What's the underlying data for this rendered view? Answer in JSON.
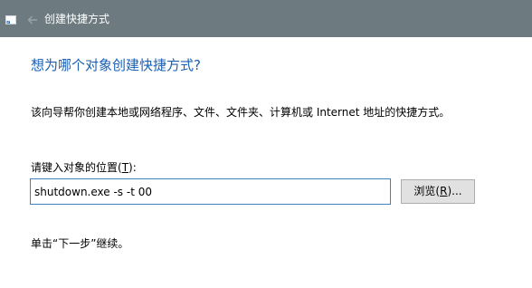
{
  "titlebar": {
    "title": "创建快捷方式",
    "background": "#6d7b81"
  },
  "icons": {
    "window_icon": "shortcut-wizard-icon",
    "back": "back-arrow-icon"
  },
  "main": {
    "heading": "想为哪个对象创建快捷方式?",
    "heading_color": "#1a5fb4",
    "description": "该向导帮你创建本地或网络程序、文件、文件夹、计算机或 Internet 地址的快捷方式。",
    "location_label_prefix": "请键入对象的位置(",
    "location_label_key": "T",
    "location_label_suffix": "):",
    "location_value": "shutdown.exe -s -t 00",
    "browse_label_prefix": "浏览(",
    "browse_label_key": "R",
    "browse_label_suffix": ")...",
    "continue_text": "单击“下一步”继续。"
  }
}
